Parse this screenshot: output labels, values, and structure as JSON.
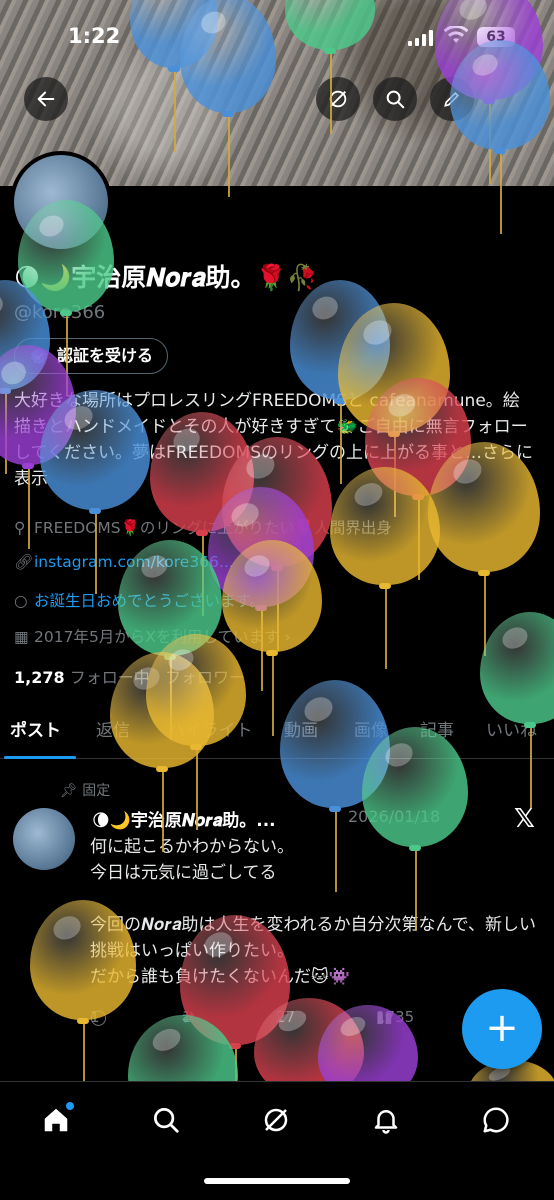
{
  "status": {
    "time": "1:22",
    "battery": "63"
  },
  "profile": {
    "name": "🌘🌙宇治原𝑵𝒐𝒓𝒂助。🌹🥀",
    "handle": "@kore366",
    "verify_label": "認証を受ける",
    "bio": "大好きな場所はプロレスリングFREEDOMSと cafeanamune。絵描きとハンドメイドとその人が好きすぎて🐲ご自由に無言フォローしてください。夢はFREEDOMSのリングの上に上がる事と…さらに表示",
    "location": "FREEDOMS🌹のリングに上がりたい🌹人間界出身",
    "website": "instagram.com/kore366...",
    "birthday": "お誕生日おめでとうございます。",
    "joined": "2017年5月からXを利用しています",
    "following_count": "1,278",
    "following_label": "フォロー中",
    "followers_label": "フォロワー"
  },
  "tabs": [
    "ポスト",
    "返信",
    "ハイライト",
    "動画",
    "画像",
    "記事",
    "いいね"
  ],
  "post": {
    "pinned_label": "固定",
    "author": "🌘🌙宇治原𝑵𝒐𝒓𝒂助。...",
    "date": "2026/01/18",
    "text": "何に起こるかわからない。\n今日は元気に過ごしてる\n\n今回の𝑵𝒐𝒓𝒂助は人生を変われるか自分次第なんで、新しい挑戦はいっぱい作りたい。\nだから誰も負けたくないんだ🐱👾",
    "replies": "1",
    "reposts": "1",
    "likes": "27",
    "views": "1735"
  },
  "colors": {
    "accent": "#1d9bf0",
    "muted": "#71767b",
    "bg": "#000000"
  },
  "icons": [
    "back-icon",
    "grok-icon",
    "search-icon",
    "edit-icon",
    "home-icon",
    "bell-icon",
    "chat-icon",
    "plus-icon"
  ]
}
